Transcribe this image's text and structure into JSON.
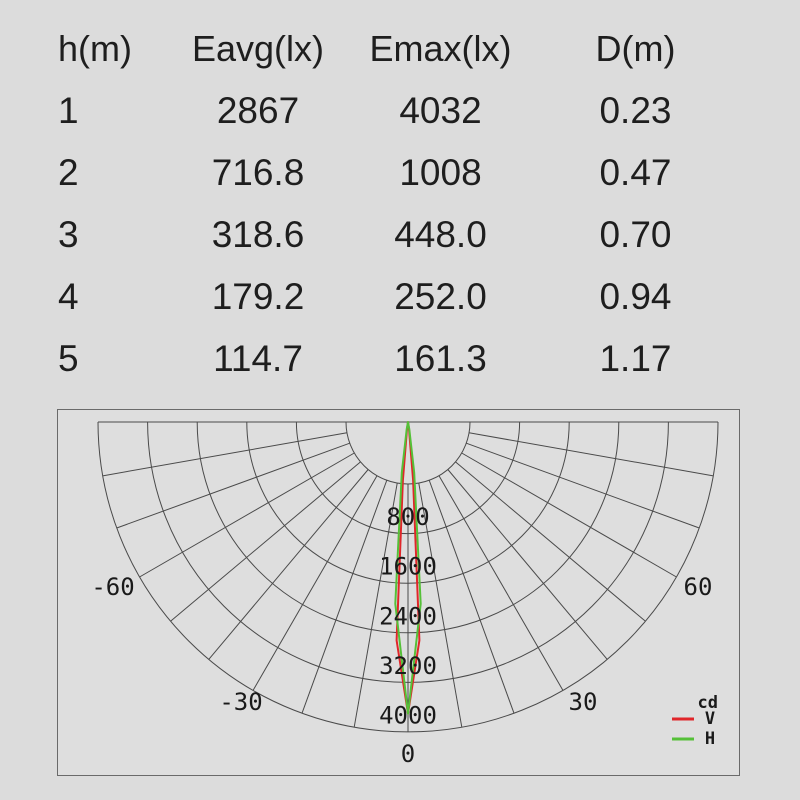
{
  "table": {
    "headers": [
      "h(m)",
      "Eavg(lx)",
      "Emax(lx)",
      "D(m)"
    ],
    "rows": [
      [
        "1",
        "2867",
        "4032",
        "0.23"
      ],
      [
        "2",
        "716.8",
        "1008",
        "0.47"
      ],
      [
        "3",
        "318.6",
        "448.0",
        "0.70"
      ],
      [
        "4",
        "179.2",
        "252.0",
        "0.94"
      ],
      [
        "5",
        "114.7",
        "161.3",
        "1.17"
      ]
    ]
  },
  "chart_data": {
    "type": "polar",
    "radial_ticks": [
      "800",
      "1600",
      "2400",
      "3200",
      "4000"
    ],
    "radial_max": 4000,
    "angle_labels": [
      "-60",
      "-30",
      "0",
      "30",
      "60"
    ],
    "unit_label": "cd",
    "grid": true,
    "legend_position": "bottom-right",
    "series": [
      {
        "name": "V",
        "color": "#e0262a",
        "angles_deg": [
          -8,
          -5,
          -3,
          0,
          3,
          5,
          8
        ],
        "values": [
          100,
          800,
          3000,
          4000,
          3000,
          800,
          100
        ]
      },
      {
        "name": "H",
        "color": "#55c038",
        "angles_deg": [
          -10,
          -7,
          -4,
          0,
          4,
          7,
          10
        ],
        "values": [
          100,
          700,
          2500,
          4000,
          2500,
          700,
          100
        ]
      }
    ]
  }
}
